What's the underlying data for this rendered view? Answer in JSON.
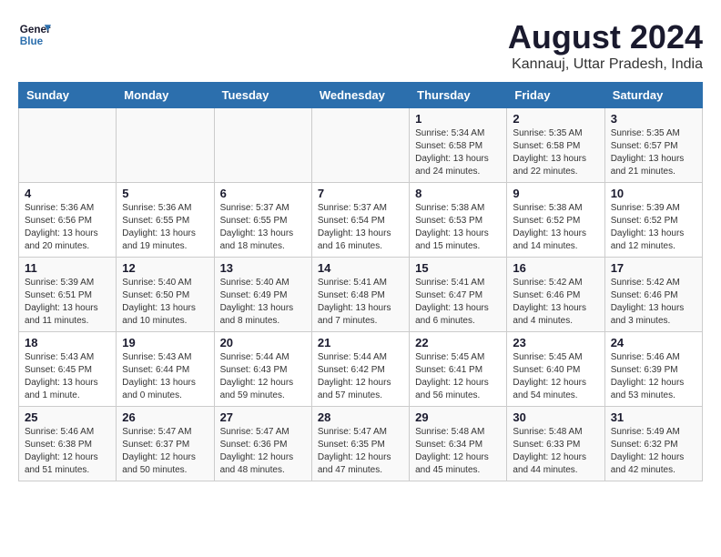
{
  "header": {
    "logo_line1": "General",
    "logo_line2": "Blue",
    "month_title": "August 2024",
    "subtitle": "Kannauj, Uttar Pradesh, India"
  },
  "weekdays": [
    "Sunday",
    "Monday",
    "Tuesday",
    "Wednesday",
    "Thursday",
    "Friday",
    "Saturday"
  ],
  "weeks": [
    [
      {
        "day": "",
        "info": ""
      },
      {
        "day": "",
        "info": ""
      },
      {
        "day": "",
        "info": ""
      },
      {
        "day": "",
        "info": ""
      },
      {
        "day": "1",
        "info": "Sunrise: 5:34 AM\nSunset: 6:58 PM\nDaylight: 13 hours\nand 24 minutes."
      },
      {
        "day": "2",
        "info": "Sunrise: 5:35 AM\nSunset: 6:58 PM\nDaylight: 13 hours\nand 22 minutes."
      },
      {
        "day": "3",
        "info": "Sunrise: 5:35 AM\nSunset: 6:57 PM\nDaylight: 13 hours\nand 21 minutes."
      }
    ],
    [
      {
        "day": "4",
        "info": "Sunrise: 5:36 AM\nSunset: 6:56 PM\nDaylight: 13 hours\nand 20 minutes."
      },
      {
        "day": "5",
        "info": "Sunrise: 5:36 AM\nSunset: 6:55 PM\nDaylight: 13 hours\nand 19 minutes."
      },
      {
        "day": "6",
        "info": "Sunrise: 5:37 AM\nSunset: 6:55 PM\nDaylight: 13 hours\nand 18 minutes."
      },
      {
        "day": "7",
        "info": "Sunrise: 5:37 AM\nSunset: 6:54 PM\nDaylight: 13 hours\nand 16 minutes."
      },
      {
        "day": "8",
        "info": "Sunrise: 5:38 AM\nSunset: 6:53 PM\nDaylight: 13 hours\nand 15 minutes."
      },
      {
        "day": "9",
        "info": "Sunrise: 5:38 AM\nSunset: 6:52 PM\nDaylight: 13 hours\nand 14 minutes."
      },
      {
        "day": "10",
        "info": "Sunrise: 5:39 AM\nSunset: 6:52 PM\nDaylight: 13 hours\nand 12 minutes."
      }
    ],
    [
      {
        "day": "11",
        "info": "Sunrise: 5:39 AM\nSunset: 6:51 PM\nDaylight: 13 hours\nand 11 minutes."
      },
      {
        "day": "12",
        "info": "Sunrise: 5:40 AM\nSunset: 6:50 PM\nDaylight: 13 hours\nand 10 minutes."
      },
      {
        "day": "13",
        "info": "Sunrise: 5:40 AM\nSunset: 6:49 PM\nDaylight: 13 hours\nand 8 minutes."
      },
      {
        "day": "14",
        "info": "Sunrise: 5:41 AM\nSunset: 6:48 PM\nDaylight: 13 hours\nand 7 minutes."
      },
      {
        "day": "15",
        "info": "Sunrise: 5:41 AM\nSunset: 6:47 PM\nDaylight: 13 hours\nand 6 minutes."
      },
      {
        "day": "16",
        "info": "Sunrise: 5:42 AM\nSunset: 6:46 PM\nDaylight: 13 hours\nand 4 minutes."
      },
      {
        "day": "17",
        "info": "Sunrise: 5:42 AM\nSunset: 6:46 PM\nDaylight: 13 hours\nand 3 minutes."
      }
    ],
    [
      {
        "day": "18",
        "info": "Sunrise: 5:43 AM\nSunset: 6:45 PM\nDaylight: 13 hours\nand 1 minute."
      },
      {
        "day": "19",
        "info": "Sunrise: 5:43 AM\nSunset: 6:44 PM\nDaylight: 13 hours\nand 0 minutes."
      },
      {
        "day": "20",
        "info": "Sunrise: 5:44 AM\nSunset: 6:43 PM\nDaylight: 12 hours\nand 59 minutes."
      },
      {
        "day": "21",
        "info": "Sunrise: 5:44 AM\nSunset: 6:42 PM\nDaylight: 12 hours\nand 57 minutes."
      },
      {
        "day": "22",
        "info": "Sunrise: 5:45 AM\nSunset: 6:41 PM\nDaylight: 12 hours\nand 56 minutes."
      },
      {
        "day": "23",
        "info": "Sunrise: 5:45 AM\nSunset: 6:40 PM\nDaylight: 12 hours\nand 54 minutes."
      },
      {
        "day": "24",
        "info": "Sunrise: 5:46 AM\nSunset: 6:39 PM\nDaylight: 12 hours\nand 53 minutes."
      }
    ],
    [
      {
        "day": "25",
        "info": "Sunrise: 5:46 AM\nSunset: 6:38 PM\nDaylight: 12 hours\nand 51 minutes."
      },
      {
        "day": "26",
        "info": "Sunrise: 5:47 AM\nSunset: 6:37 PM\nDaylight: 12 hours\nand 50 minutes."
      },
      {
        "day": "27",
        "info": "Sunrise: 5:47 AM\nSunset: 6:36 PM\nDaylight: 12 hours\nand 48 minutes."
      },
      {
        "day": "28",
        "info": "Sunrise: 5:47 AM\nSunset: 6:35 PM\nDaylight: 12 hours\nand 47 minutes."
      },
      {
        "day": "29",
        "info": "Sunrise: 5:48 AM\nSunset: 6:34 PM\nDaylight: 12 hours\nand 45 minutes."
      },
      {
        "day": "30",
        "info": "Sunrise: 5:48 AM\nSunset: 6:33 PM\nDaylight: 12 hours\nand 44 minutes."
      },
      {
        "day": "31",
        "info": "Sunrise: 5:49 AM\nSunset: 6:32 PM\nDaylight: 12 hours\nand 42 minutes."
      }
    ]
  ]
}
